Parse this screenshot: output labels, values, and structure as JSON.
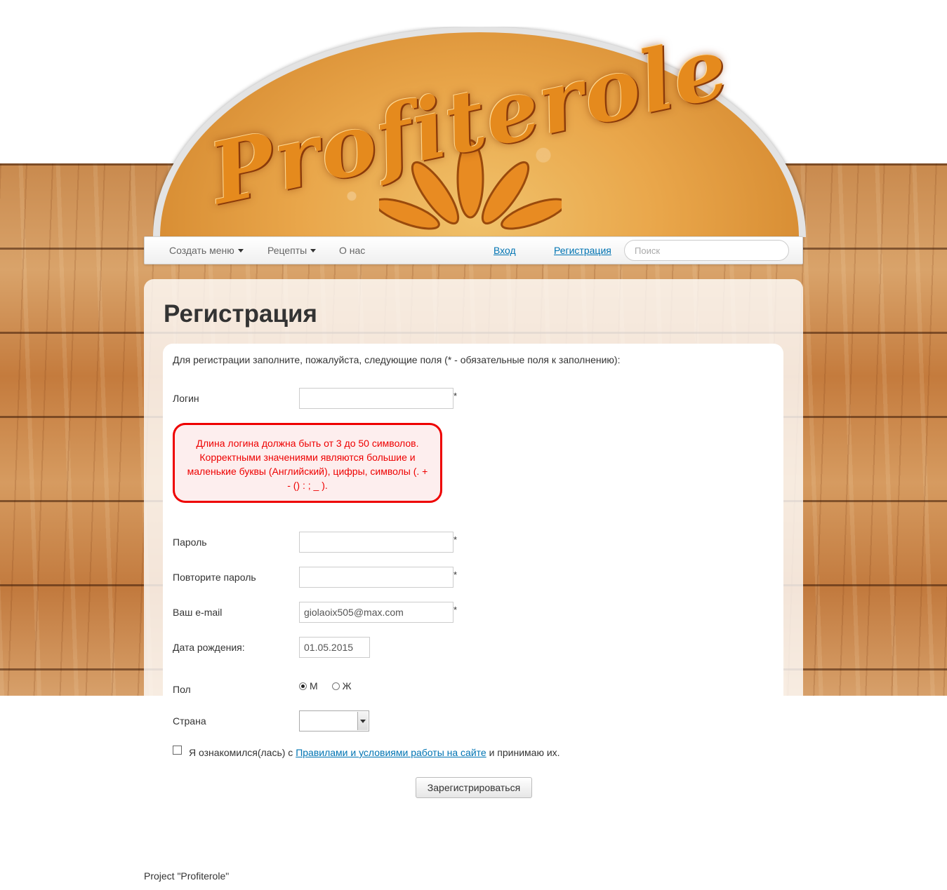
{
  "logo": {
    "text": "Profiterole"
  },
  "nav": {
    "items": [
      {
        "label": "Создать меню",
        "has_dropdown": true
      },
      {
        "label": "Рецепты",
        "has_dropdown": true
      },
      {
        "label": "О нас",
        "has_dropdown": false
      }
    ],
    "login_label": "Вход",
    "register_label": "Регистрация",
    "search_placeholder": "Поиск"
  },
  "page": {
    "title": "Регистрация",
    "intro": "Для регистрации заполните, пожалуйста, следующие поля (* - обязательные поля к заполнению):"
  },
  "form": {
    "login": {
      "label": "Логин",
      "value": "",
      "required_mark": "*"
    },
    "login_error": "Длина логина должна быть от 3 до 50 символов. Корректными значениями являются большие и маленькие буквы (Английский), цифры, символы (. + - () : ; _ ).",
    "password": {
      "label": "Пароль",
      "value": "",
      "required_mark": "*"
    },
    "password_repeat": {
      "label": "Повторите пароль",
      "value": "",
      "required_mark": "*"
    },
    "email": {
      "label": "Ваш e-mail",
      "value": "giolaoix505@max.com",
      "required_mark": "*"
    },
    "birthdate": {
      "label": "Дата рождения:",
      "value": "01.05.2015"
    },
    "gender": {
      "label": "Пол",
      "options": [
        {
          "label": "М",
          "checked": true
        },
        {
          "label": "Ж",
          "checked": false
        }
      ]
    },
    "country": {
      "label": "Страна",
      "value": ""
    },
    "agree": {
      "prefix": "Я ознакомился(лась) с",
      "link": "Правилами и условиями работы на сайте",
      "suffix": "и принимаю их.",
      "checked": false
    },
    "submit_label": "Зарегистрироваться"
  },
  "footer": {
    "text": "Project \"Profiterole\""
  },
  "colors": {
    "error": "#e00000",
    "link": "#0074b3",
    "wood": "#c98a4e",
    "logo": "#e9a64a"
  }
}
